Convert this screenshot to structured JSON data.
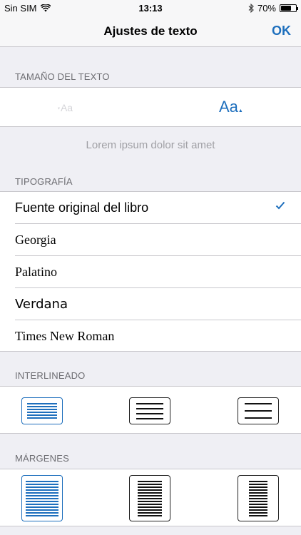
{
  "status_bar": {
    "carrier": "Sin SIM",
    "time": "13:13",
    "battery": "70%",
    "battery_level": 0.7
  },
  "nav": {
    "title": "Ajustes de texto",
    "done_label": "OK"
  },
  "text_size": {
    "header": "TAMAÑO DEL TEXTO",
    "decrease_label": "Aa",
    "increase_label": "Aa"
  },
  "preview": "Lorem ipsum dolor sit amet",
  "typography": {
    "header": "TIPOGRAFÍA",
    "fonts": [
      {
        "label": "Fuente original del libro",
        "selected": true
      },
      {
        "label": "Georgia",
        "selected": false
      },
      {
        "label": "Palatino",
        "selected": false
      },
      {
        "label": "Verdana",
        "selected": false
      },
      {
        "label": "Times New Roman",
        "selected": false
      }
    ]
  },
  "line_spacing": {
    "header": "INTERLINEADO",
    "options": [
      "compact",
      "normal",
      "wide"
    ],
    "selected": "compact"
  },
  "margins": {
    "header": "MÁRGENES",
    "options": [
      "narrow",
      "medium",
      "wide"
    ],
    "selected": "narrow"
  },
  "colors": {
    "accent": "#1e6fbd",
    "background": "#efeff4",
    "separator": "#c8c7cc"
  }
}
